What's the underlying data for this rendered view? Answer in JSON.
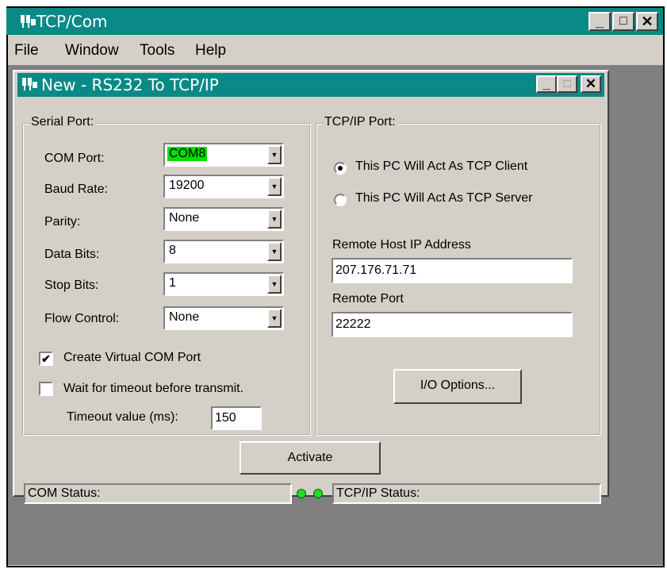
{
  "app": {
    "title": "TCP/Com",
    "menu": [
      "File",
      "Window",
      "Tools",
      "Help"
    ],
    "controls": {
      "minimize": "_",
      "maximize": "□",
      "close": "✕"
    }
  },
  "child_window": {
    "title": "New - RS232 To TCP/IP"
  },
  "serial_port": {
    "legend": "Serial Port:",
    "com_port": {
      "label": "COM Port:",
      "value": "COM8"
    },
    "baud_rate": {
      "label": "Baud Rate:",
      "value": "19200"
    },
    "parity": {
      "label": "Parity:",
      "value": "None"
    },
    "data_bits": {
      "label": "Data Bits:",
      "value": "8"
    },
    "stop_bits": {
      "label": "Stop Bits:",
      "value": "1"
    },
    "flow_control": {
      "label": "Flow Control:",
      "value": "None"
    },
    "create_virtual": {
      "label": "Create Virtual COM Port",
      "checked": true
    },
    "wait_timeout": {
      "label": "Wait for timeout before transmit.",
      "checked": false
    },
    "timeout_value": {
      "label": "Timeout value (ms):",
      "value": "150"
    }
  },
  "tcp_port": {
    "legend": "TCP/IP Port:",
    "client_option": {
      "label": "This PC Will Act As TCP Client",
      "selected": true
    },
    "server_option": {
      "label": "This PC Will Act As TCP Server",
      "selected": false
    },
    "remote_host": {
      "label": "Remote Host IP Address",
      "value": "207.176.71.71"
    },
    "remote_port": {
      "label": "Remote Port",
      "value": "22222"
    },
    "io_options": "I/O Options..."
  },
  "activate_label": "Activate",
  "status": {
    "com": "COM Status:",
    "tcp": "TCP/IP Status:"
  },
  "colors": {
    "titlebar": "#0a8a86",
    "face": "#d4d0c8",
    "mdi_background": "#808080",
    "com_highlight": "#00dd00",
    "led": "#22dd22"
  },
  "icons": {
    "app": "network-plug-icon",
    "child": "network-plug-icon",
    "combo_arrow": "chevron-down-icon"
  }
}
